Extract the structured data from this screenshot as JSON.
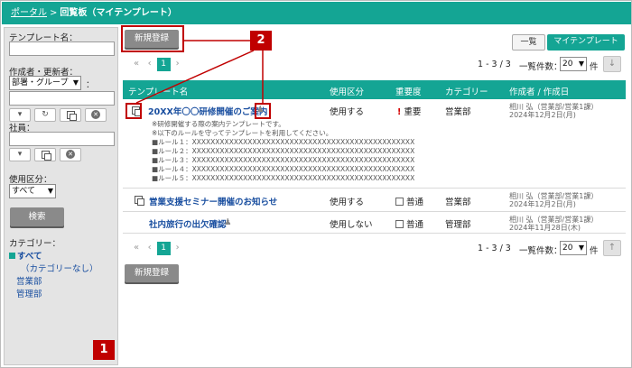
{
  "header": {
    "portal": "ポータル",
    "separator": ">",
    "title": "回覧板（マイテンプレート）"
  },
  "sidebar": {
    "template_name_label": "テンプレート名：",
    "author_label": "作成者・更新者：",
    "group_select": "部署・グループ",
    "colon": "：",
    "member_label": "社員：",
    "usage_label": "使用区分：",
    "usage_select": "すべて",
    "search_button": "検索",
    "category_label": "カテゴリー：",
    "categories": [
      "すべて",
      "（カテゴリーなし）",
      "営業部",
      "管理部"
    ]
  },
  "toolbar": {
    "new_button": "新規登録",
    "tab_list": "一覧",
    "tab_my_template": "マイテンプレート",
    "pager_first": "«",
    "pager_prev": "‹",
    "pager_current": "1",
    "pager_next": "›",
    "range": "1 - 3 / 3",
    "per_page_label": "一覧件数：",
    "per_page_value": "20",
    "per_page_unit": "件"
  },
  "table": {
    "headers": [
      "テンプレート名",
      "使用区分",
      "重要度",
      "カテゴリー",
      "作成者 / 作成日"
    ],
    "rows": [
      {
        "title": "20XX年〇〇研修開催のご案内",
        "usage": "使用する",
        "importance": "重要",
        "category": "営業部",
        "author": "相川 弘（営業部/営業1課）",
        "date": "2024年12月2日(月)",
        "details": [
          "※研修開催する際の案内テンプレートです。",
          "※以下のルールを守ってテンプレートを利用してください。",
          "■ルール１：XXXXXXXXXXXXXXXXXXXXXXXXXXXXXXXXXXXXXXXXXXXXXXXX",
          "■ルール２：XXXXXXXXXXXXXXXXXXXXXXXXXXXXXXXXXXXXXXXXXXXXXXXX",
          "■ルール３：XXXXXXXXXXXXXXXXXXXXXXXXXXXXXXXXXXXXXXXXXXXXXXXX",
          "■ルール４：XXXXXXXXXXXXXXXXXXXXXXXXXXXXXXXXXXXXXXXXXXXXXXXX",
          "■ルール５：XXXXXXXXXXXXXXXXXXXXXXXXXXXXXXXXXXXXXXXXXXXXXXXX"
        ]
      },
      {
        "title": "営業支援セミナー開催のお知らせ",
        "usage": "使用する",
        "importance": "普通",
        "category": "営業部",
        "author": "相川 弘（営業部/営業1課）",
        "date": "2024年12月2日(月)"
      },
      {
        "title": "社内旅行の出欠確認",
        "usage": "使用しない",
        "importance": "普通",
        "category": "管理部",
        "author": "相川 弘（営業部/営業1課）",
        "date": "2024年11月28日(木)"
      }
    ]
  },
  "callouts": {
    "one": "1",
    "two": "2"
  },
  "colors": {
    "brand": "#14a594",
    "callout": "#c00000",
    "link": "#1a4fa0"
  }
}
